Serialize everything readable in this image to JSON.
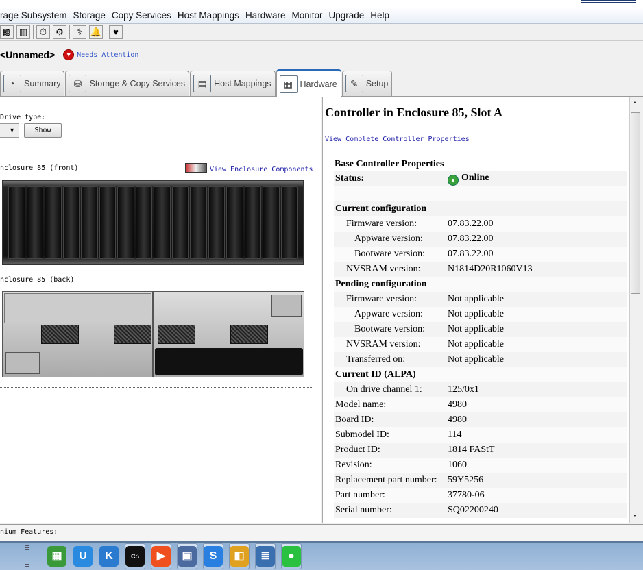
{
  "menu": [
    "rage Subsystem",
    "Storage",
    "Copy Services",
    "Host Mappings",
    "Hardware",
    "Monitor",
    "Upgrade",
    "Help"
  ],
  "toolbar_icons": [
    "storage-icon",
    "book-icon",
    "timer-icon",
    "gears-icon",
    "stethoscope-icon",
    "bell-icon",
    "heart-icon"
  ],
  "header": {
    "title": "<Unnamed>",
    "status": "Needs Attention"
  },
  "tabs": [
    {
      "label": "Summary",
      "icon": "summary-icon"
    },
    {
      "label": "Storage & Copy Services",
      "icon": "storage-icon"
    },
    {
      "label": "Host Mappings",
      "icon": "host-icon"
    },
    {
      "label": "Hardware",
      "icon": "hardware-icon",
      "active": true
    },
    {
      "label": "Setup",
      "icon": "setup-icon"
    }
  ],
  "left": {
    "drive_type_label": "Drive type:",
    "show_button": "Show",
    "front_label": "nclosure 85 (front)",
    "view_components": "View Enclosure Components",
    "back_label": "nclosure 85 (back)",
    "drive_count": 16
  },
  "right": {
    "title": "Controller in Enclosure 85, Slot A",
    "view_link": "View Complete Controller Properties",
    "section": "Base Controller Properties",
    "rows": [
      {
        "k": "Status:",
        "v": "Online",
        "type": "status"
      },
      {
        "k": "",
        "v": ""
      },
      {
        "k": "Current configuration",
        "type": "hdr"
      },
      {
        "k": "Firmware version:",
        "v": "07.83.22.00",
        "lvl": 1
      },
      {
        "k": "Appware version:",
        "v": "07.83.22.00",
        "lvl": 2
      },
      {
        "k": "Bootware version:",
        "v": "07.83.22.00",
        "lvl": 2
      },
      {
        "k": "NVSRAM version:",
        "v": "N1814D20R1060V13",
        "lvl": 1
      },
      {
        "k": "Pending configuration",
        "type": "hdr"
      },
      {
        "k": "Firmware version:",
        "v": "Not applicable",
        "lvl": 1
      },
      {
        "k": "Appware version:",
        "v": "Not applicable",
        "lvl": 2
      },
      {
        "k": "Bootware version:",
        "v": "Not applicable",
        "lvl": 2
      },
      {
        "k": "NVSRAM version:",
        "v": "Not applicable",
        "lvl": 1
      },
      {
        "k": "Transferred on:",
        "v": "Not applicable",
        "lvl": 1
      },
      {
        "k": "Current ID (ALPA)",
        "type": "hdr"
      },
      {
        "k": "On drive channel 1:",
        "v": "125/0x1",
        "lvl": 1
      },
      {
        "k": "Model name:",
        "v": "4980"
      },
      {
        "k": "Board ID:",
        "v": "4980"
      },
      {
        "k": "Submodel ID:",
        "v": "114"
      },
      {
        "k": "Product ID:",
        "v": "1814 FAStT"
      },
      {
        "k": "Revision:",
        "v": "1060"
      },
      {
        "k": "Replacement part number:",
        "v": "59Y5256"
      },
      {
        "k": "Part number:",
        "v": "37780-06"
      },
      {
        "k": "Serial number:",
        "v": "SQ02200240"
      }
    ]
  },
  "statusbar": {
    "text": "nium Features:"
  },
  "taskbar": [
    {
      "name": "windows-icon",
      "color": "#3a9a3a",
      "glyph": "▦"
    },
    {
      "name": "u-app-icon",
      "color": "#2a8ae0",
      "glyph": "U"
    },
    {
      "name": "k-app-icon",
      "color": "#2a7ad0",
      "glyph": "K"
    },
    {
      "name": "cmd-icon",
      "color": "#111",
      "glyph": "C:\\",
      "btn": true
    },
    {
      "name": "media-app-icon",
      "color": "#f05020",
      "glyph": "▶",
      "btn": true
    },
    {
      "name": "network-app-icon",
      "color": "#4a6aa0",
      "glyph": "▣",
      "btn": true
    },
    {
      "name": "sogou-icon",
      "color": "#2a80e0",
      "glyph": "S",
      "btn": true
    },
    {
      "name": "office-app-icon",
      "color": "#e0a020",
      "glyph": "◧",
      "btn": true
    },
    {
      "name": "database-icon",
      "color": "#3a70b0",
      "glyph": "≣",
      "btn": true
    },
    {
      "name": "wechat-icon",
      "color": "#2ac040",
      "glyph": "●",
      "btn": true
    }
  ]
}
